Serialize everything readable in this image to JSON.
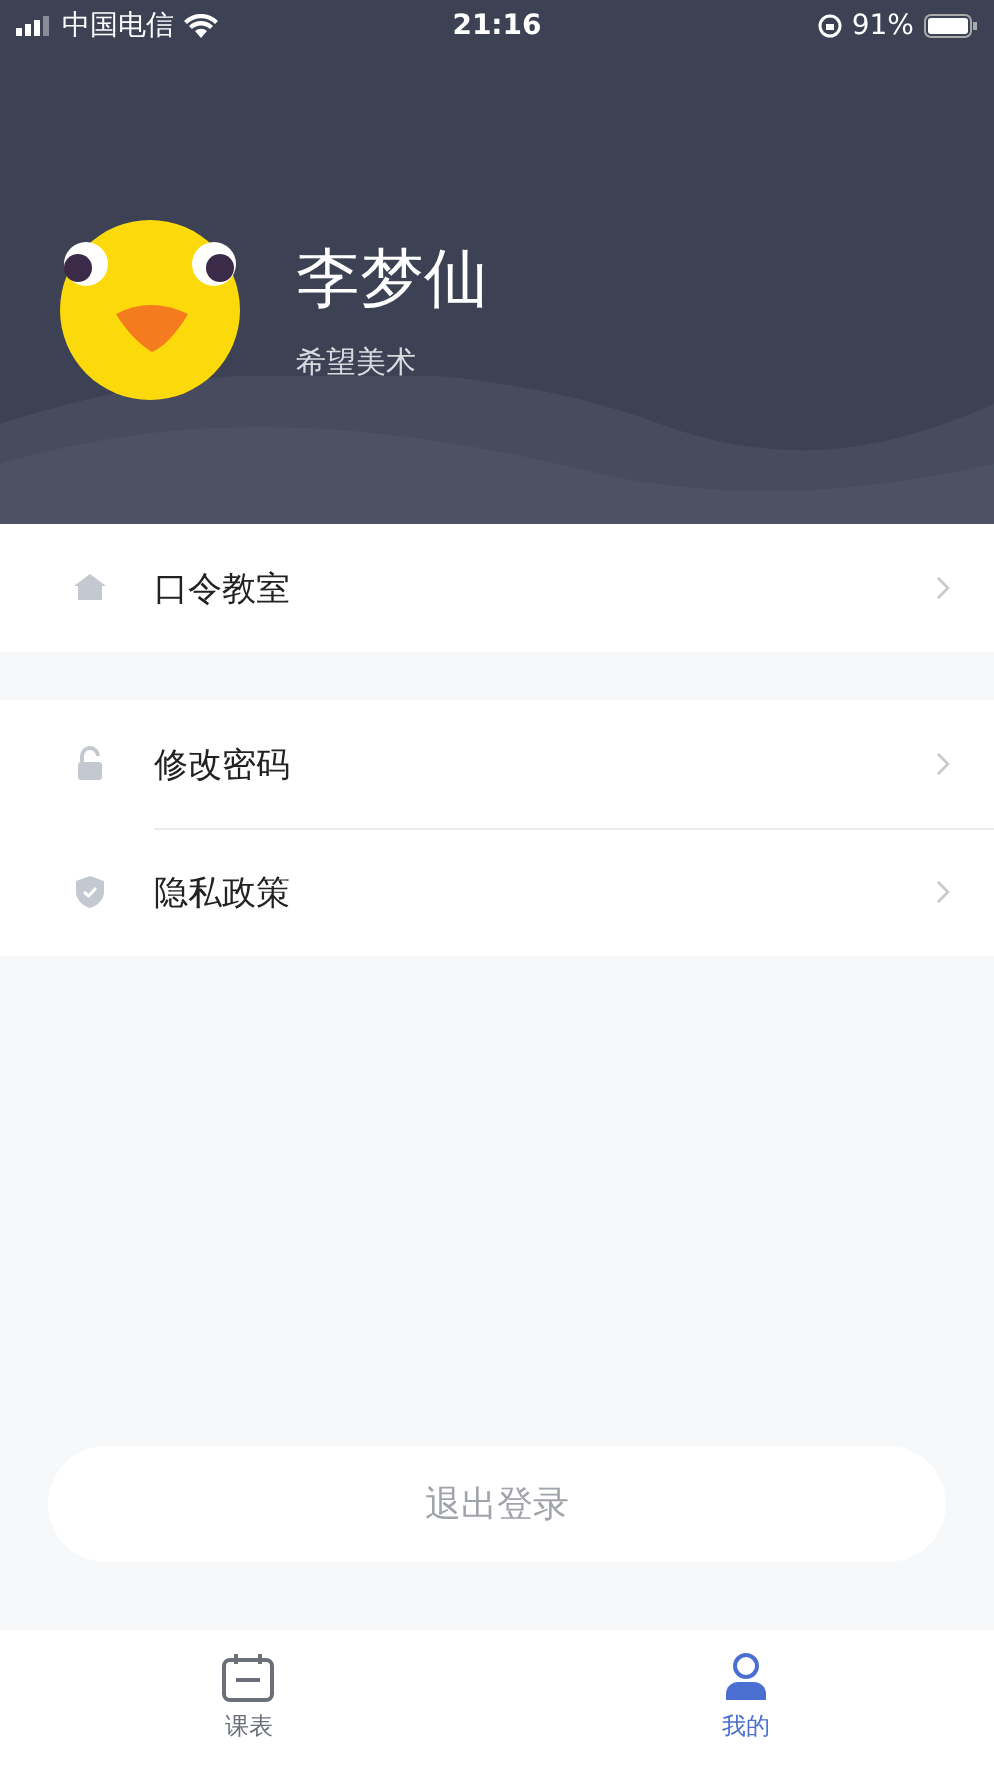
{
  "status_bar": {
    "carrier": "中国电信",
    "time": "21:16",
    "battery": "91%"
  },
  "profile": {
    "name": "李梦仙",
    "organization": "希望美术"
  },
  "menu_groups": [
    {
      "items": [
        {
          "kind": "home",
          "label": "口令教室"
        }
      ]
    },
    {
      "items": [
        {
          "kind": "lock",
          "label": "修改密码"
        },
        {
          "kind": "shield",
          "label": "隐私政策"
        }
      ]
    }
  ],
  "logout_button": "退出登录",
  "tabs": [
    {
      "kind": "calendar",
      "label": "课表",
      "selected": false
    },
    {
      "kind": "person",
      "label": "我的",
      "selected": true
    }
  ]
}
